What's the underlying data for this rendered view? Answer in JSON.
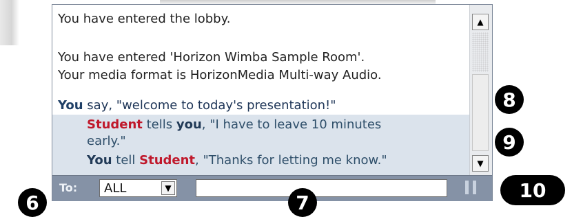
{
  "messages": {
    "sys1": "You have entered the lobby.",
    "sys2": "You have entered 'Horizon Wimba Sample Room'.",
    "sys3": "Your media format is HorizonMedia Multi-way Audio.",
    "say_you": "You",
    "say_rest": " say, \"welcome to today's presentation!\"",
    "tell1_from": "Student",
    "tell1_mid": " tells ",
    "tell1_to": "you",
    "tell1_text": ", \"I have to leave 10 minutes",
    "tell1_cont": "early.\"",
    "tell2_you": "You",
    "tell2_mid": " tell ",
    "tell2_to": "Student",
    "tell2_text": ", \"Thanks for letting me know.\""
  },
  "toolbar": {
    "to_label": "To:",
    "recipient": "ALL",
    "input_value": "",
    "pause_icon": "pause-icon"
  },
  "scrollbar": {
    "up_arrow": "▲",
    "down_arrow": "▼"
  },
  "callouts": {
    "c6": "6",
    "c7": "7",
    "c8": "8",
    "c9": "9",
    "c10": "10"
  },
  "colors": {
    "toolbar_bg": "#8592a6",
    "highlight_bg": "#dbe3ec",
    "student_red": "#c0182b",
    "text_blue": "#2d4b6e"
  }
}
